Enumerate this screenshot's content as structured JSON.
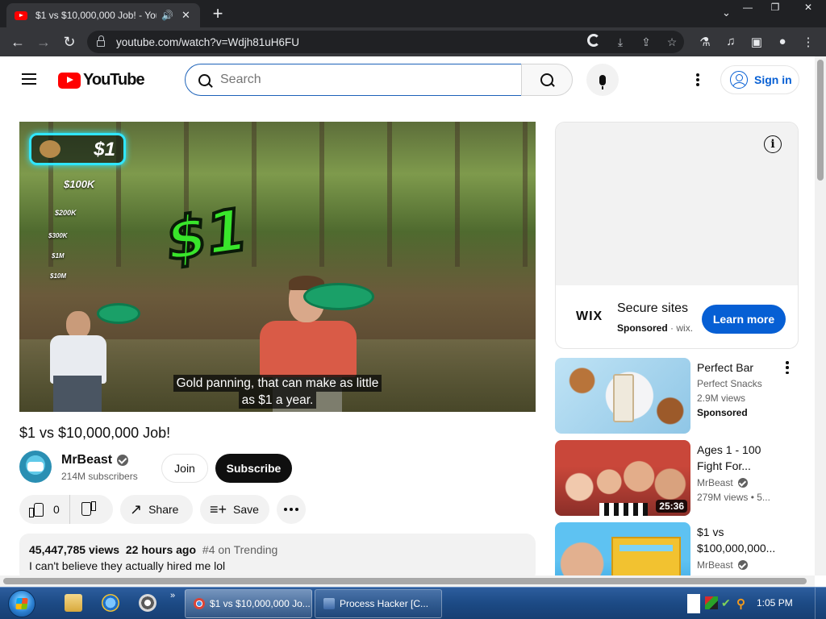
{
  "browser": {
    "tab_title": "$1 vs $10,000,000 Job! - YouTube",
    "url": "youtube.com/watch?v=Wdjh81uH6FU",
    "window_controls": [
      "—",
      "❐",
      "✕"
    ]
  },
  "header": {
    "logo_text": "YouTube",
    "search_placeholder": "Search",
    "signin_label": "Sign in"
  },
  "player": {
    "hud_amount": "$1",
    "ladder": [
      "$100K",
      "$200K",
      "$300K",
      "$1M",
      "$10M"
    ],
    "big_overlay": "$1",
    "caption_line1": "Gold panning, that can make as little",
    "caption_line2": "as $1 a year."
  },
  "video": {
    "title": "$1 vs $10,000,000 Job!",
    "channel": "MrBeast",
    "subscribers": "214M subscribers",
    "join_label": "Join",
    "subscribe_label": "Subscribe",
    "like_count": "0",
    "share_label": "Share",
    "save_label": "Save",
    "views": "45,447,785 views",
    "age": "22 hours ago",
    "trending": "#4 on Trending",
    "description": "I can't believe they actually hired me lol"
  },
  "ad": {
    "brand": "WIX",
    "title": "Secure sites",
    "sponsored": "Sponsored",
    "domain": "wix.",
    "cta": "Learn more"
  },
  "recommendations": [
    {
      "title": "Perfect Bar",
      "channel": "Perfect Snacks",
      "meta": "2.9M views",
      "sponsored": "Sponsored",
      "duration": ""
    },
    {
      "title": "Ages 1 - 100 Fight For...",
      "channel": "MrBeast",
      "meta": "279M views  • 5...",
      "duration": "25:36"
    },
    {
      "title": "$1 vs $100,000,000...",
      "channel": "MrBeast",
      "meta": "",
      "duration": ""
    }
  ],
  "taskbar": {
    "task_chrome": "$1 vs $10,000,000 Jo...",
    "task_processhacker": "Process Hacker [C...",
    "clock": "1:05 PM"
  },
  "colors": {
    "youtube_red": "#ff0000",
    "link_blue": "#065fd4",
    "chrome_dark": "#35363a",
    "taskbar_blue": "#1c4a85"
  }
}
